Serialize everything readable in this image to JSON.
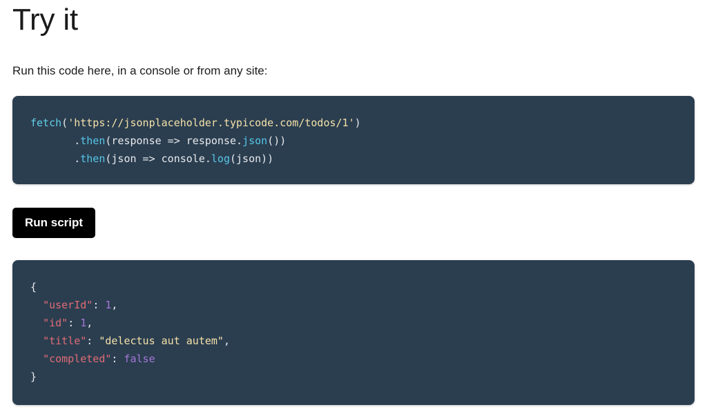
{
  "page": {
    "title": "Try it",
    "intro": "Run this code here, in a console or from any site:"
  },
  "code_block": {
    "language": "javascript",
    "background_color": "#2b3e50",
    "lines": [
      {
        "tokens": [
          {
            "text": "fetch",
            "type": "function"
          },
          {
            "text": "(",
            "type": "plain"
          },
          {
            "text": "'https://jsonplaceholder.typicode.com/todos/1'",
            "type": "string"
          },
          {
            "text": ")",
            "type": "plain"
          }
        ]
      },
      {
        "tokens": [
          {
            "text": "       .",
            "type": "plain"
          },
          {
            "text": "then",
            "type": "method"
          },
          {
            "text": "(response => response.",
            "type": "plain"
          },
          {
            "text": "json",
            "type": "method"
          },
          {
            "text": "())",
            "type": "plain"
          }
        ]
      },
      {
        "tokens": [
          {
            "text": "       .",
            "type": "plain"
          },
          {
            "text": "then",
            "type": "method"
          },
          {
            "text": "(json => console.",
            "type": "plain"
          },
          {
            "text": "log",
            "type": "method"
          },
          {
            "text": "(json))",
            "type": "plain"
          }
        ]
      }
    ]
  },
  "run_button": {
    "label": "Run script",
    "background_color": "#000000",
    "text_color": "#ffffff"
  },
  "output_block": {
    "background_color": "#2b3e50",
    "lines": [
      {
        "tokens": [
          {
            "text": "{",
            "type": "punctuation"
          }
        ]
      },
      {
        "tokens": [
          {
            "text": "  ",
            "type": "plain"
          },
          {
            "text": "\"userId\"",
            "type": "key"
          },
          {
            "text": ": ",
            "type": "punctuation"
          },
          {
            "text": "1",
            "type": "number"
          },
          {
            "text": ",",
            "type": "punctuation"
          }
        ]
      },
      {
        "tokens": [
          {
            "text": "  ",
            "type": "plain"
          },
          {
            "text": "\"id\"",
            "type": "key"
          },
          {
            "text": ": ",
            "type": "punctuation"
          },
          {
            "text": "1",
            "type": "number"
          },
          {
            "text": ",",
            "type": "punctuation"
          }
        ]
      },
      {
        "tokens": [
          {
            "text": "  ",
            "type": "plain"
          },
          {
            "text": "\"title\"",
            "type": "key"
          },
          {
            "text": ": ",
            "type": "punctuation"
          },
          {
            "text": "\"delectus aut autem\"",
            "type": "string"
          },
          {
            "text": ",",
            "type": "punctuation"
          }
        ]
      },
      {
        "tokens": [
          {
            "text": "  ",
            "type": "plain"
          },
          {
            "text": "\"completed\"",
            "type": "key"
          },
          {
            "text": ": ",
            "type": "punctuation"
          },
          {
            "text": "false",
            "type": "boolean"
          }
        ]
      },
      {
        "tokens": [
          {
            "text": "}",
            "type": "punctuation"
          }
        ]
      }
    ]
  },
  "colors": {
    "code_background": "#2b3e50",
    "function": "#61d0e8",
    "method": "#56c7e8",
    "string": "#f4e1a8",
    "key": "#e06c75",
    "number": "#a477d6",
    "boolean": "#a477d6",
    "plain_text": "#e8eaed",
    "page_background": "#ffffff",
    "body_text": "#1b1b1b"
  }
}
